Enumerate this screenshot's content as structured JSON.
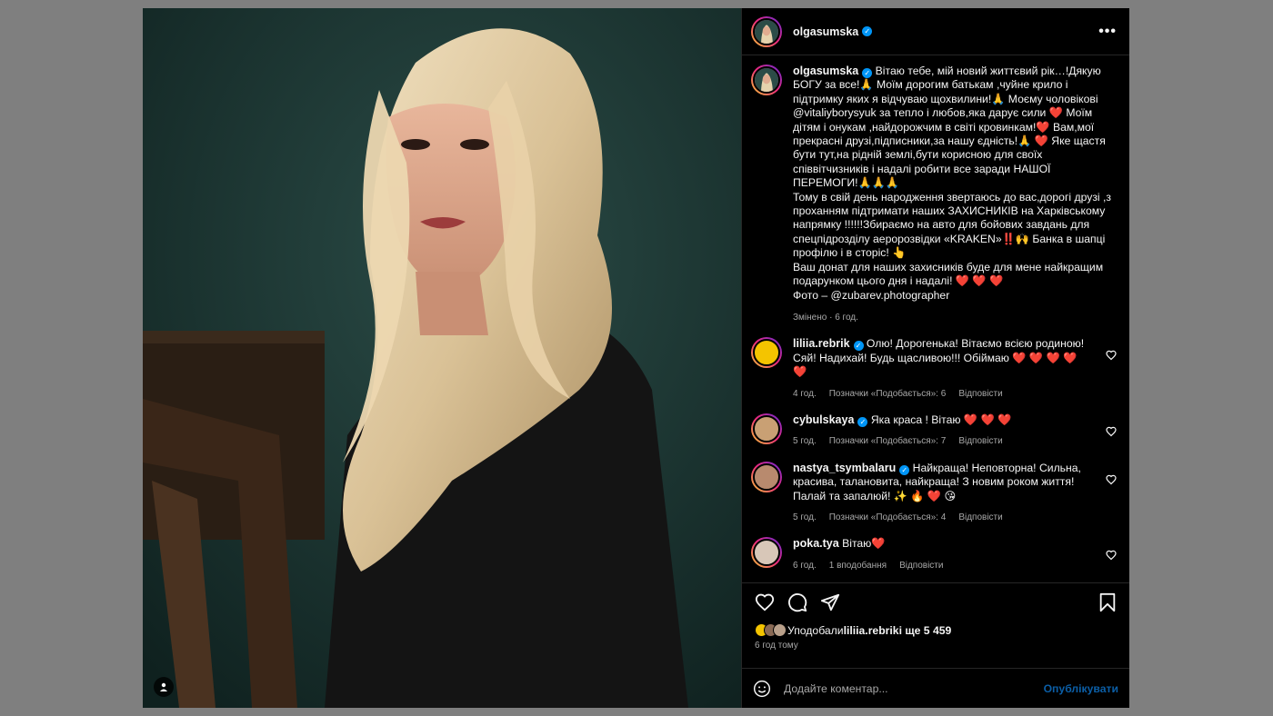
{
  "post": {
    "author": "olgasumska",
    "author_avatar_icon": "profile-photo",
    "more_label": "•••",
    "caption": "Вітаю тебе, мій новий життєвий рік…!Дякую БОГУ за все!🙏 Моїм дорогим батькам ,чуйне крило і підтримку яких я відчуваю щохвилини!🙏 Моєму чоловікові @vitaliyborysyuk за тепло і любов,яка дарує сили ❤️ Моїм дітям і онукам ,найдорожчим в світі кровинкам!❤️ Вам,мої прекрасні друзі,підписники,за нашу єдність!🙏 ❤️ Яке щастя бути тут,на рідній землі,бути корисною для своїх співвітчизників і надалі робити все заради НАШОЇ ПЕРЕМОГИ!🙏🙏🙏\nТому в свій день народження звертаюсь до вас,дорогі друзі ,з проханням підтримати наших ЗАХИСНИКІВ на Харківському напрямку !!!!!!Збираємо на авто для бойових завдань для спецпідрозділу аеророзвідки «KRAKEN»‼️🙌 Банка в шапці профілю і в сторіс! 👆\nВаш донат для наших захисників буде для мене найкращим подарунком цього дня і надалі! ❤️ ❤️ ❤️\nФото – @zubarev.photographer",
    "caption_meta": "Змінено · 6 год."
  },
  "comments": [
    {
      "user": "liliia.rebrik",
      "verified": true,
      "text": "Олю! Дорогенька! Вітаємо всією родиною! Сяй! Надихай! Будь щасливою!!! Обіймаю ❤️ ❤️ ❤️ ❤️ ❤️",
      "time": "4 год.",
      "likes": "Позначки «Подобається»: 6",
      "reply": "Відповісти",
      "avatar_color": "#f4c400"
    },
    {
      "user": "cybulskaya",
      "verified": true,
      "text": "Яка краса ! Вітаю ❤️ ❤️ ❤️",
      "time": "5 год.",
      "likes": "Позначки «Подобається»: 7",
      "reply": "Відповісти",
      "avatar_color": "#c9a074"
    },
    {
      "user": "nastya_tsymbalaru",
      "verified": true,
      "text": "Найкраща! Неповторна! Сильна, красива, талановита, найкраща! З новим роком життя! Палай та запалюй! ✨ 🔥 ❤️ 😘",
      "time": "5 год.",
      "likes": "Позначки «Подобається»: 4",
      "reply": "Відповісти",
      "avatar_color": "#b88a6e"
    },
    {
      "user": "poka.tya",
      "verified": false,
      "text": "Вітаю❤️",
      "time": "6 год.",
      "likes": "1 вподобання",
      "reply": "Відповісти",
      "avatar_color": "#d8c7b8"
    }
  ],
  "actions": {
    "likes_prefix": "Уподобали ",
    "likes_user": "liliia.rebrik",
    "likes_suffix": " і ще 5 459",
    "time": "6 год тому"
  },
  "add_comment": {
    "placeholder": "Додайте коментар...",
    "publish": "Опублікувати"
  },
  "colors": {
    "accent": "#0095f6",
    "heart": "#ff3040",
    "background": "#000000",
    "muted": "#a8a8a8"
  }
}
